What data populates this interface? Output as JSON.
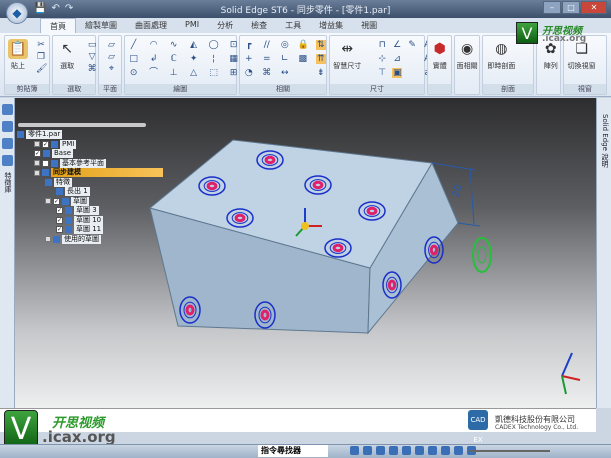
{
  "title": "Solid Edge ST6 - 同步零件 - [零件1.par]",
  "qat": [
    "💾",
    "↶",
    "↷"
  ],
  "tabs": [
    "首頁",
    "繪製草圖",
    "曲面處理",
    "PMI",
    "分析",
    "檢查",
    "工具",
    "增益集",
    "視圖"
  ],
  "ribbon": {
    "groups": [
      "剪貼簿",
      "選取",
      "平面",
      "繪圖",
      "相關",
      "尺寸",
      "",
      "剖面",
      "視窗"
    ],
    "buttons": {
      "paste": "貼上",
      "select": "選取",
      "smart_dim": "智慧尺寸",
      "solid": "實體",
      "face_rel": "面相關",
      "live_section": "即時剖面",
      "pattern": "陣列",
      "switch_window": "切換視窗"
    }
  },
  "left_panel_label": "特徵庫",
  "right_panel_label": "Solid Edge 說明",
  "tree": [
    {
      "label": "零件1.par",
      "level": 0
    },
    {
      "label": "PMI",
      "level": 1
    },
    {
      "label": "Base",
      "level": 1
    },
    {
      "label": "基本參考平面",
      "level": 1
    },
    {
      "label": "同步建模",
      "level": 1,
      "selected": true
    },
    {
      "label": "特徵",
      "level": 2
    },
    {
      "label": "長出 1",
      "level": 3
    },
    {
      "label": "草圖",
      "level": 2
    },
    {
      "label": "草圖 3",
      "level": 3
    },
    {
      "label": "草圖 10",
      "level": 3
    },
    {
      "label": "草圖 11",
      "level": 3
    },
    {
      "label": "使用的草圖",
      "level": 2
    }
  ],
  "dimension_value": "20",
  "watermark": {
    "cn": "开思视频",
    "url": ".icax.org",
    "v": "V"
  },
  "cadex": {
    "logo": "CAD EX",
    "cn": "凱德科技股份有限公司",
    "en": "CADEX Technology Co., Ltd."
  },
  "status": {
    "command_finder": "指令尋找器"
  },
  "colors": {
    "selection": "#f0a820",
    "hole_ring": "#1a2fc8",
    "hole_center": "#e0206a",
    "block": "#b3c9dd"
  }
}
